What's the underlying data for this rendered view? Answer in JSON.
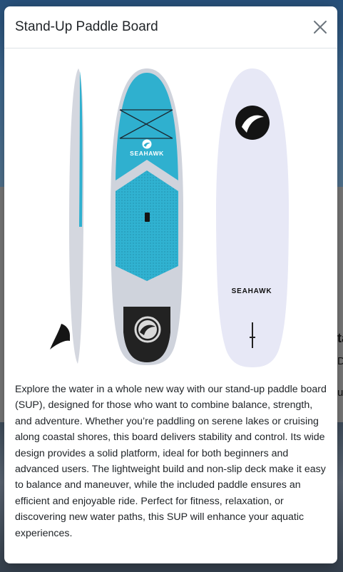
{
  "modal": {
    "title": "Stand-Up Paddle Board",
    "close_icon": "close-icon",
    "description": "Explore the water in a whole new way with our stand-up paddle board (SUP), designed for those who want to combine balance, strength, and adventure. Whether you’re paddling on serene lakes or cruising along coastal shores, this board delivers stability and control. Its wide design provides a solid platform, ideal for both beginners and advanced users. The lightweight build and non-slip deck make it easy to balance and maneuver, while the included paddle ensures an efficient and enjoyable ride. Perfect for fitness, relaxation, or discovering new water paths, this SUP will enhance your aquatic experiences."
  },
  "board": {
    "brand_front": "SEAHAWK",
    "brand_back": "SEAHAWK",
    "colors": {
      "deck": "#2fb0cf",
      "rail": "#cfd3dc",
      "bottom": "#e7e8f6",
      "tail_pad": "#222222"
    }
  },
  "background": {
    "fragment_1": "ta",
    "fragment_2": "D",
    "fragment_3": "u"
  }
}
